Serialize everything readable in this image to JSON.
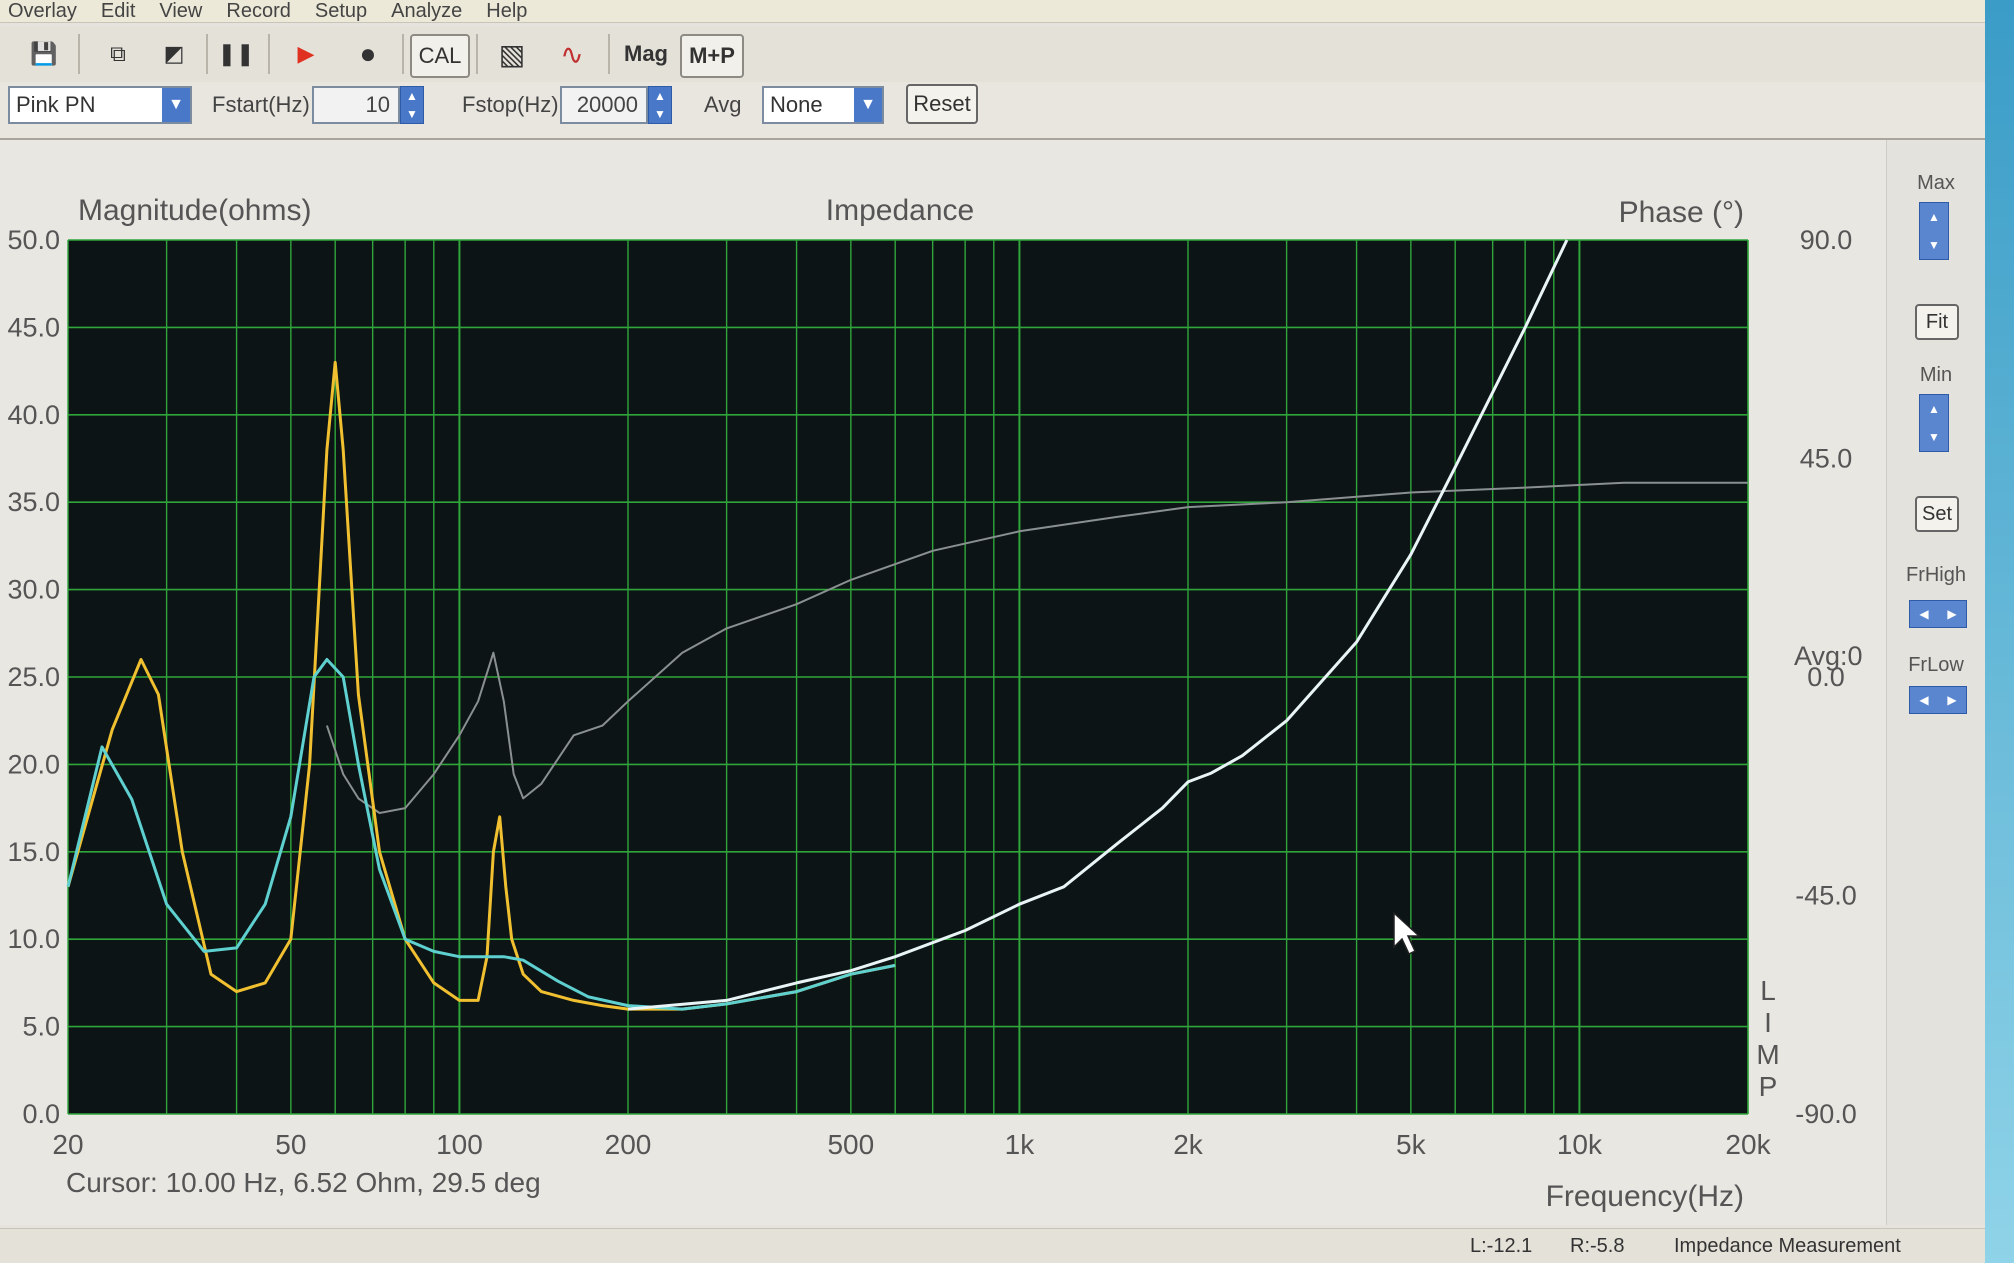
{
  "menu": [
    "Overlay",
    "Edit",
    "View",
    "Record",
    "Setup",
    "Analyze",
    "Help"
  ],
  "toolbar": {
    "buttons": [
      {
        "name": "save-icon",
        "glyph": "💾"
      },
      {
        "name": "copy-icon",
        "glyph": "⧉"
      },
      {
        "name": "edit-icon",
        "glyph": "◩"
      },
      {
        "name": "pause-icon",
        "glyph": "❚❚"
      },
      {
        "name": "play-icon",
        "glyph": "▶"
      },
      {
        "name": "record-icon",
        "glyph": "●"
      },
      {
        "name": "cal-button",
        "label": "CAL"
      },
      {
        "name": "hatch-icon",
        "glyph": "▧"
      },
      {
        "name": "wave-icon",
        "glyph": "∿"
      },
      {
        "name": "mag-button",
        "label": "Mag"
      },
      {
        "name": "mp-button",
        "label": "M+P"
      }
    ]
  },
  "controls": {
    "signal": "Pink PN",
    "fstart_label": "Fstart(Hz)",
    "fstart": "10",
    "fstop_label": "Fstop(Hz)",
    "fstop": "20000",
    "avg_label": "Avg",
    "avg": "None",
    "reset": "Reset"
  },
  "side": {
    "max": "Max",
    "fit": "Fit",
    "min": "Min",
    "set": "Set",
    "frhigh": "FrHigh",
    "frlow": "FrLow"
  },
  "status": {
    "left_level": "L:-12.1",
    "right_level": "R:-5.8",
    "mode": "Impedance Measurement"
  },
  "colors": {
    "plot_bg": "#0d1416",
    "grid": "#2fa53a",
    "yellow": "#f0c030",
    "cyan": "#5fd0d0",
    "phase": "#8a9090",
    "white": "#e8f4f6"
  },
  "chart_data": {
    "type": "line",
    "title": "Impedance",
    "ylabel": "Magnitude(ohms)",
    "y2label": "Phase (°)",
    "xlabel": "Frequency(Hz)",
    "x_scale": "log",
    "xlim": [
      20,
      20000
    ],
    "ylim": [
      0,
      50
    ],
    "y2lim": [
      -90,
      90
    ],
    "grid": true,
    "x_ticks": [
      {
        "v": 20,
        "label": "20"
      },
      {
        "v": 50,
        "label": "50"
      },
      {
        "v": 100,
        "label": "100"
      },
      {
        "v": 200,
        "label": "200"
      },
      {
        "v": 500,
        "label": "500"
      },
      {
        "v": 1000,
        "label": "1k"
      },
      {
        "v": 2000,
        "label": "2k"
      },
      {
        "v": 5000,
        "label": "5k"
      },
      {
        "v": 10000,
        "label": "10k"
      },
      {
        "v": 20000,
        "label": "20k"
      }
    ],
    "y_ticks": [
      "0.0",
      "5.0",
      "10.0",
      "15.0",
      "20.0",
      "25.0",
      "30.0",
      "35.0",
      "40.0",
      "45.0",
      "50.0"
    ],
    "y2_ticks": [
      "90.0",
      "45.0",
      "0.0",
      "-45.0",
      "-90.0"
    ],
    "avg_label": "Avg:0",
    "side_letters": [
      "L",
      "I",
      "M",
      "P"
    ],
    "cursor_text": "Cursor: 10.00 Hz, 6.52 Ohm, 29.5 deg",
    "series": [
      {
        "key": "yellow",
        "x": [
          20,
          24,
          27,
          29,
          32,
          36,
          40,
          45,
          50,
          54,
          58,
          60,
          62,
          66,
          72,
          80,
          90,
          100,
          108,
          112,
          115,
          118,
          121,
          124,
          130,
          140,
          160,
          180,
          200,
          250,
          300,
          400,
          500,
          600
        ],
        "y": [
          13,
          22,
          26,
          24,
          15,
          8,
          7,
          7.5,
          10,
          20,
          38,
          43,
          38,
          24,
          15,
          10,
          7.5,
          6.5,
          6.5,
          9,
          15,
          17,
          13,
          10,
          8,
          7,
          6.5,
          6.2,
          6,
          6,
          6.3,
          7,
          8,
          8.5
        ]
      },
      {
        "key": "cyan",
        "x": [
          20,
          23,
          26,
          30,
          35,
          40,
          45,
          50,
          55,
          58,
          62,
          66,
          72,
          80,
          90,
          100,
          110,
          120,
          130,
          150,
          170,
          200,
          250,
          300,
          400,
          500,
          600
        ],
        "y": [
          13,
          21,
          18,
          12,
          9.3,
          9.5,
          12,
          17,
          25,
          26,
          25,
          20,
          14,
          10,
          9.3,
          9,
          9,
          9,
          8.8,
          7.6,
          6.7,
          6.2,
          6,
          6.3,
          7,
          8,
          8.5
        ]
      },
      {
        "key": "white",
        "x": [
          200,
          300,
          400,
          500,
          600,
          800,
          1000,
          1200,
          1500,
          1800,
          2000,
          2200,
          2500,
          3000,
          4000,
          5000,
          6000,
          8000,
          9500
        ],
        "y": [
          6,
          6.5,
          7.5,
          8.2,
          9,
          10.5,
          12,
          13,
          15.5,
          17.5,
          19,
          19.5,
          20.5,
          22.5,
          27,
          32,
          37,
          45,
          50
        ]
      },
      {
        "key": "phase",
        "x": [
          58,
          62,
          66,
          72,
          80,
          90,
          100,
          108,
          115,
          120,
          125,
          130,
          140,
          160,
          180,
          200,
          250,
          300,
          400,
          500,
          700,
          1000,
          1500,
          2000,
          3000,
          5000,
          8000,
          12000,
          16000,
          20000
        ],
        "y": [
          -10,
          -20,
          -25,
          -28,
          -27,
          -20,
          -12,
          -5,
          5,
          -5,
          -20,
          -25,
          -22,
          -12,
          -10,
          -5,
          5,
          10,
          15,
          20,
          26,
          30,
          33,
          35,
          36,
          38,
          39,
          40,
          40,
          40
        ]
      }
    ]
  }
}
